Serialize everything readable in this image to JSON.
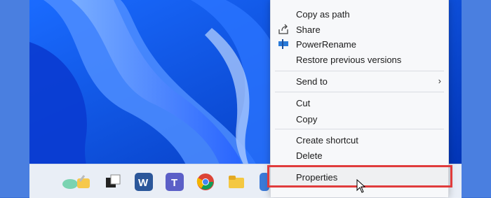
{
  "context_menu": {
    "items": [
      {
        "label": "Copy as path",
        "icon": ""
      },
      {
        "label": "Share",
        "icon": "share-icon"
      },
      {
        "label": "PowerRename",
        "icon": "powerrename-icon"
      },
      {
        "label": "Restore previous versions",
        "icon": ""
      },
      {
        "label": "Send to",
        "icon": "",
        "submenu": true
      },
      {
        "label": "Cut",
        "icon": ""
      },
      {
        "label": "Copy",
        "icon": ""
      },
      {
        "label": "Create shortcut",
        "icon": ""
      },
      {
        "label": "Delete",
        "icon": ""
      },
      {
        "label": "Properties",
        "icon": ""
      }
    ],
    "submenu_arrow": "›"
  },
  "taskbar": {
    "icons": [
      "widgets-icon",
      "task-view-icon",
      "word-icon",
      "teams-icon",
      "chrome-icon",
      "file-explorer-icon",
      "app-icon"
    ]
  },
  "highlight_color": "#e03c3c",
  "desktop_color": "#0b4fe6"
}
